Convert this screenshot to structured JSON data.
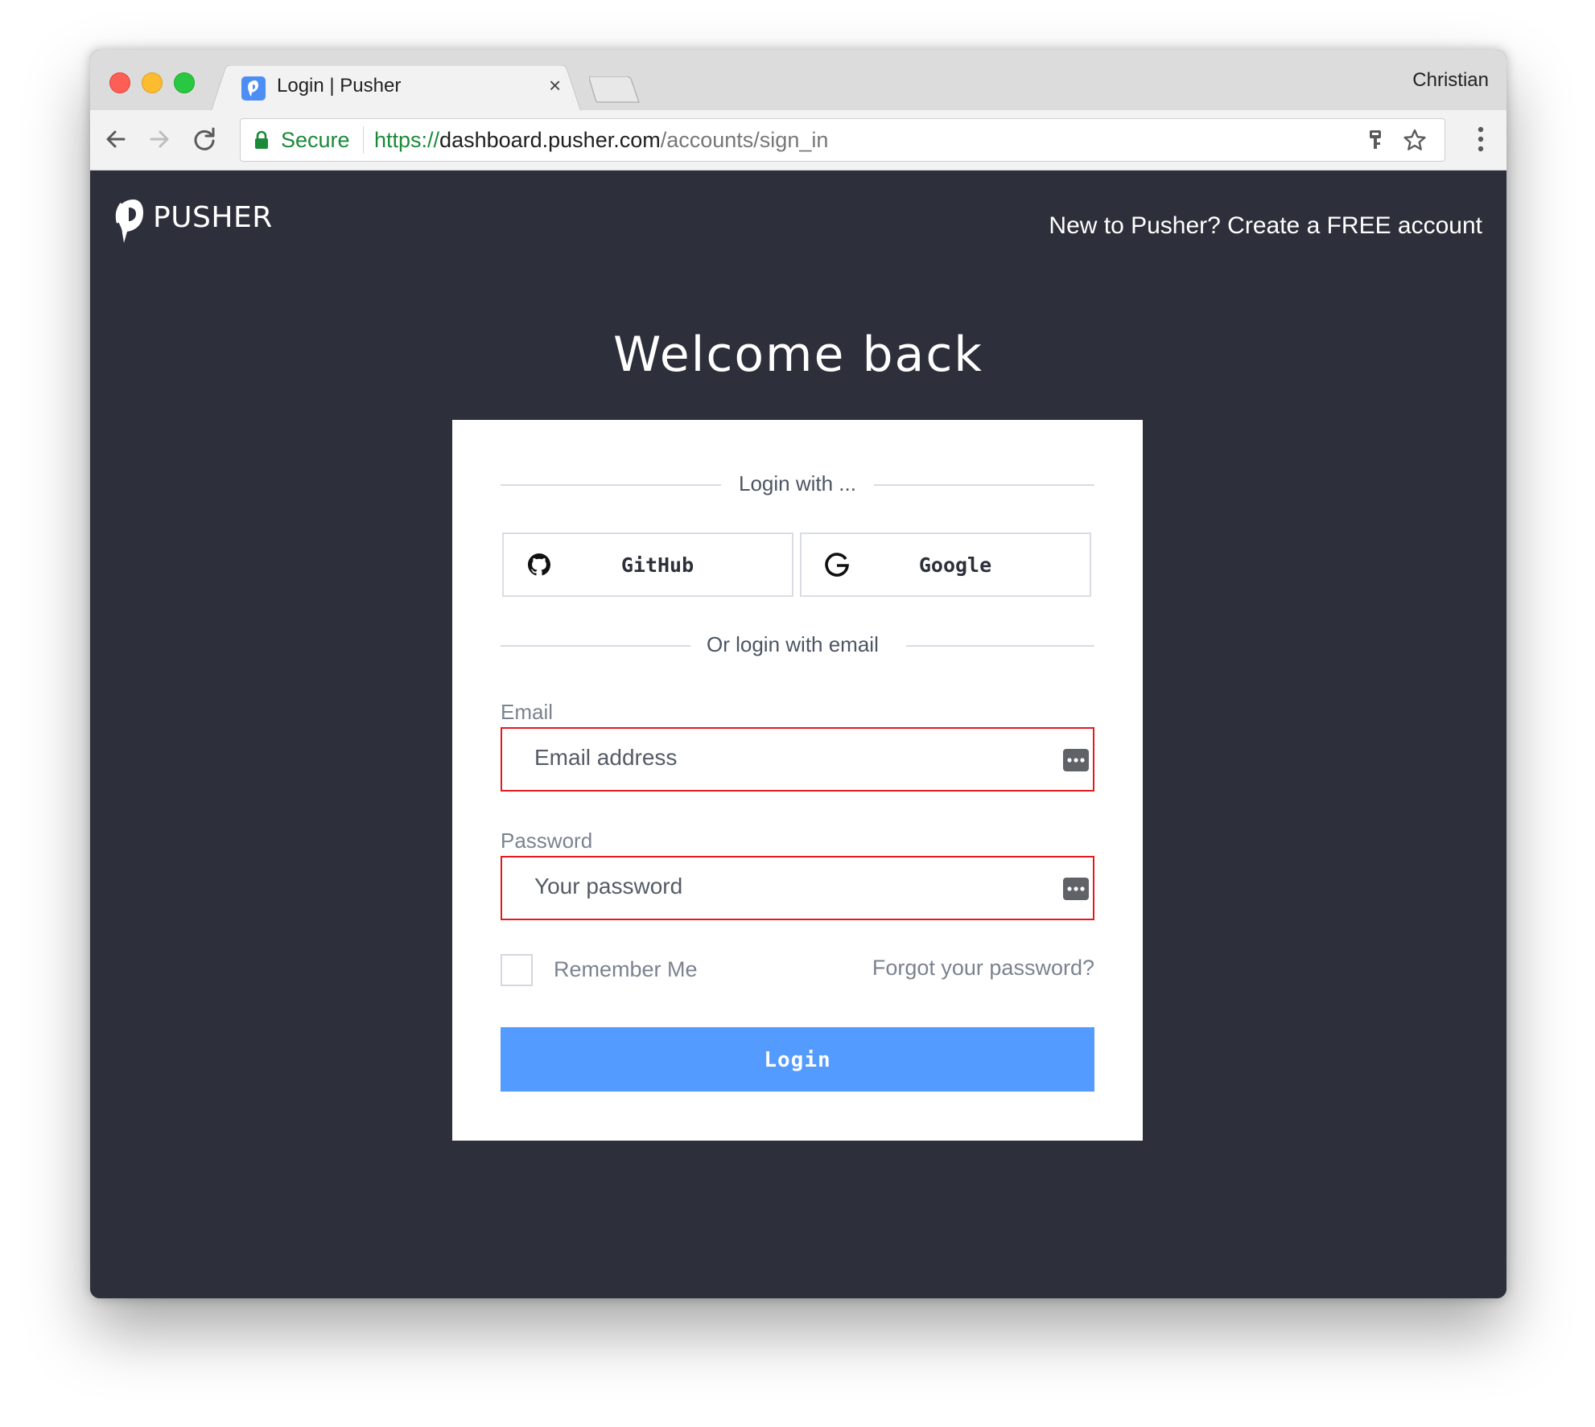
{
  "browser": {
    "tab_title": "Login | Pusher",
    "tab_close": "×",
    "profile_name": "Christian",
    "secure_label": "Secure",
    "url": {
      "scheme": "https://",
      "host": "dashboard.pusher.com",
      "path": "/accounts/sign_in"
    }
  },
  "header": {
    "logo_text": "PUSHER",
    "signup_link": "New to Pusher? Create a FREE account"
  },
  "main": {
    "title": "Welcome back"
  },
  "login_card": {
    "oauth_divider": "Login with ...",
    "github_label": "GitHub",
    "google_label": "Google",
    "email_divider": "Or login with email",
    "email_label": "Email",
    "email_placeholder": "Email address",
    "email_value": "",
    "password_label": "Password",
    "password_placeholder": "Your password",
    "password_value": "",
    "remember_label": "Remember Me",
    "remember_checked": false,
    "forgot_link": "Forgot your password?",
    "login_button": "Login"
  },
  "icons": {
    "favicon": "pusher-favicon-icon",
    "lock": "lock-icon",
    "key": "key-icon",
    "star": "bookmark-star-icon",
    "github": "github-icon",
    "google": "google-icon",
    "password_manager": "password-manager-icon"
  },
  "colors": {
    "page_background": "#2d303b",
    "login_button": "#539bff",
    "field_error_border": "#e3191f",
    "secure_green": "#1a8a39"
  }
}
